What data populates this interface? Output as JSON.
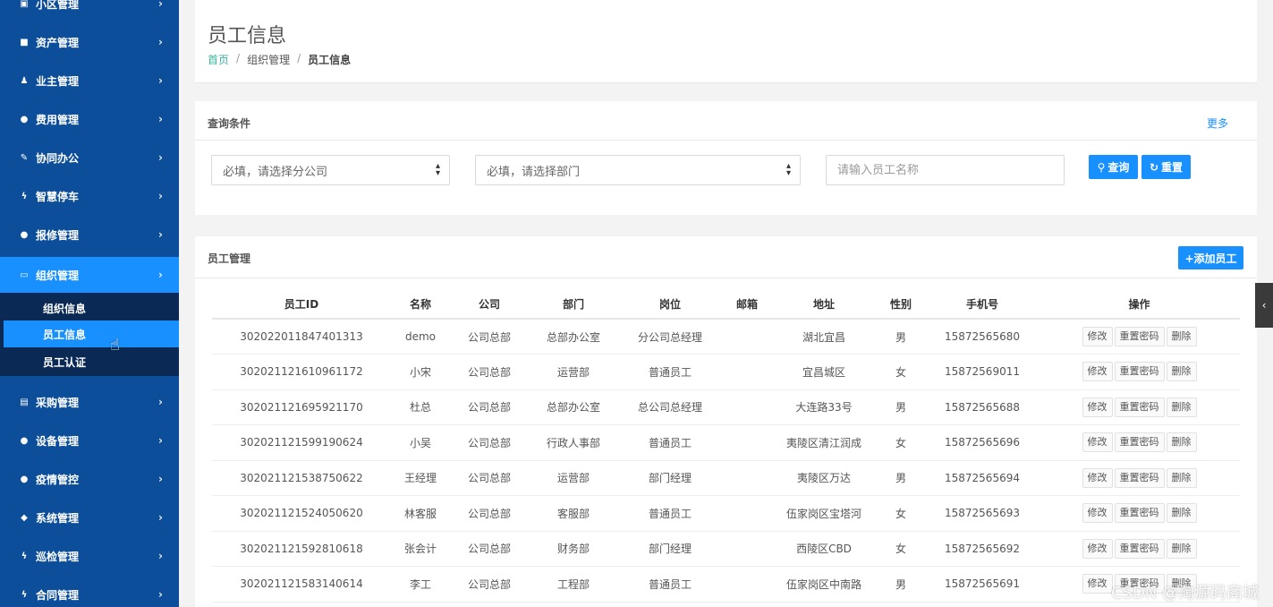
{
  "sidebar": {
    "items": [
      {
        "icon": "building-icon",
        "glyph": "▣",
        "label": "小区管理"
      },
      {
        "icon": "grid-icon",
        "glyph": "■",
        "label": "资产管理"
      },
      {
        "icon": "user-icon",
        "glyph": "♟",
        "label": "业主管理"
      },
      {
        "icon": "globe-icon",
        "glyph": "●",
        "label": "费用管理"
      },
      {
        "icon": "edit-icon",
        "glyph": "✎",
        "label": "协同办公"
      },
      {
        "icon": "bolt-icon",
        "glyph": "ϟ",
        "label": "智慧停车"
      },
      {
        "icon": "globe-icon",
        "glyph": "●",
        "label": "报修管理"
      },
      {
        "icon": "monitor-icon",
        "glyph": "▭",
        "label": "组织管理"
      },
      {
        "icon": "clipboard-icon",
        "glyph": "▤",
        "label": "采购管理"
      },
      {
        "icon": "globe-icon",
        "glyph": "●",
        "label": "设备管理"
      },
      {
        "icon": "globe-icon",
        "glyph": "●",
        "label": "疫情管控"
      },
      {
        "icon": "diamond-icon",
        "glyph": "◆",
        "label": "系统管理"
      },
      {
        "icon": "bolt-icon",
        "glyph": "ϟ",
        "label": "巡检管理"
      },
      {
        "icon": "bolt-icon",
        "glyph": "ϟ",
        "label": "合同管理"
      }
    ],
    "chevron": "›",
    "submenu": [
      {
        "label": "组织信息"
      },
      {
        "label": "员工信息"
      },
      {
        "label": "员工认证"
      }
    ]
  },
  "header": {
    "title": "员工信息",
    "breadcrumb": {
      "home": "首页",
      "parent": "组织管理",
      "current": "员工信息",
      "sep": "/"
    }
  },
  "query": {
    "title": "查询条件",
    "more": "更多",
    "company_select": "必填，请选择分公司",
    "dept_select": "必填，请选择部门",
    "name_placeholder": "请输入员工名称",
    "search_button": "查询",
    "reset_button": "重置"
  },
  "staff": {
    "title": "员工管理",
    "add_button": "+添加员工",
    "columns": [
      "员工ID",
      "名称",
      "公司",
      "部门",
      "岗位",
      "邮箱",
      "地址",
      "性别",
      "手机号",
      "操作"
    ],
    "actions": {
      "edit": "修改",
      "reset_pwd": "重置密码",
      "delete": "删除"
    },
    "rows": [
      {
        "id": "302022011847401313",
        "name": "demo",
        "company": "公司总部",
        "dept": "总部办公室",
        "post": "分公司总经理",
        "email": "",
        "address": "湖北宜昌",
        "gender": "男",
        "phone": "15872565680"
      },
      {
        "id": "302021121610961172",
        "name": "小宋",
        "company": "公司总部",
        "dept": "运营部",
        "post": "普通员工",
        "email": "",
        "address": "宜昌城区",
        "gender": "女",
        "phone": "15872569011"
      },
      {
        "id": "302021121695921170",
        "name": "杜总",
        "company": "公司总部",
        "dept": "总部办公室",
        "post": "总公司总经理",
        "email": "",
        "address": "大连路33号",
        "gender": "男",
        "phone": "15872565688"
      },
      {
        "id": "302021121599190624",
        "name": "小吴",
        "company": "公司总部",
        "dept": "行政人事部",
        "post": "普通员工",
        "email": "",
        "address": "夷陵区清江润成",
        "gender": "女",
        "phone": "15872565696"
      },
      {
        "id": "302021121538750622",
        "name": "王经理",
        "company": "公司总部",
        "dept": "运营部",
        "post": "部门经理",
        "email": "",
        "address": "夷陵区万达",
        "gender": "男",
        "phone": "15872565694"
      },
      {
        "id": "302021121524050620",
        "name": "林客服",
        "company": "公司总部",
        "dept": "客服部",
        "post": "普通员工",
        "email": "",
        "address": "伍家岗区宝塔河",
        "gender": "女",
        "phone": "15872565693"
      },
      {
        "id": "302021121592810618",
        "name": "张会计",
        "company": "公司总部",
        "dept": "财务部",
        "post": "部门经理",
        "email": "",
        "address": "西陵区CBD",
        "gender": "女",
        "phone": "15872565692"
      },
      {
        "id": "302021121583140614",
        "name": "李工",
        "company": "公司总部",
        "dept": "工程部",
        "post": "普通员工",
        "email": "",
        "address": "伍家岗区中南路",
        "gender": "男",
        "phone": "15872565691"
      }
    ]
  },
  "side_tab": "‹",
  "watermark": "CSDN @淘源码商城"
}
